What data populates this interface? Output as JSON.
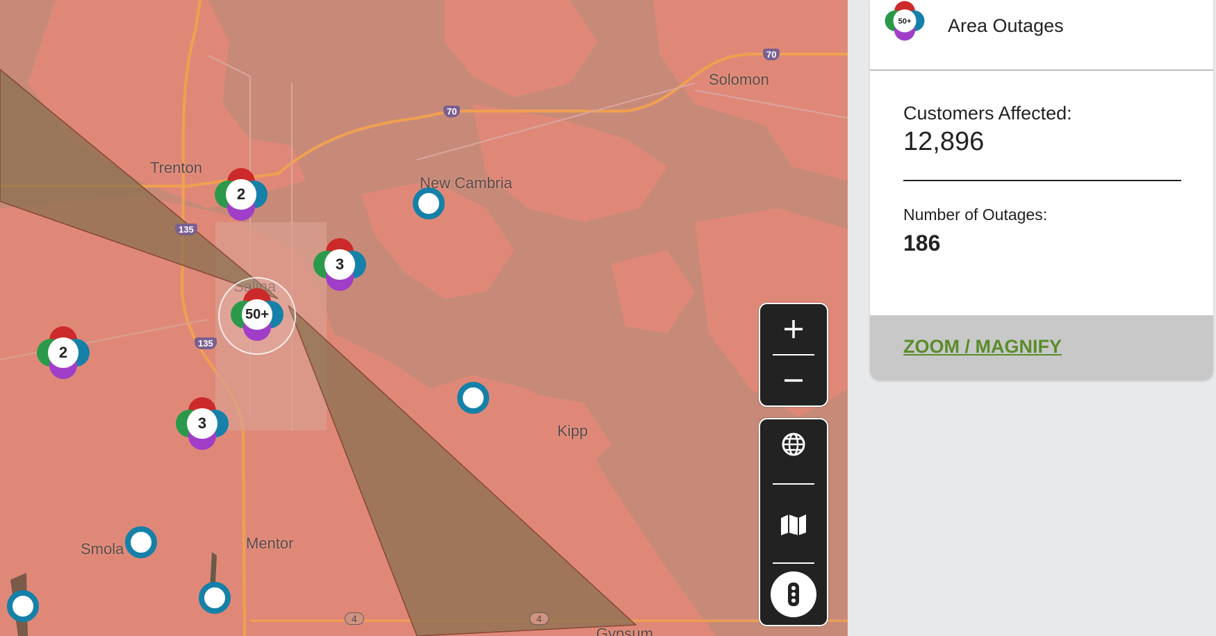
{
  "map": {
    "places": [
      {
        "name": "Trenton"
      },
      {
        "name": "New Cambria"
      },
      {
        "name": "Solomon"
      },
      {
        "name": "Salina"
      },
      {
        "name": "Kipp"
      },
      {
        "name": "Smola"
      },
      {
        "name": "Mentor"
      },
      {
        "name": "Gypsum"
      }
    ],
    "interstates": [
      "70",
      "70",
      "135",
      "135"
    ],
    "state_routes": [
      "4",
      "4"
    ],
    "clusters": [
      {
        "label": "2"
      },
      {
        "label": "3"
      },
      {
        "label": "50+"
      },
      {
        "label": "2"
      },
      {
        "label": "3"
      }
    ],
    "colors": {
      "cluster_red": "#cc2a2a",
      "cluster_green": "#2a9a4a",
      "cluster_blue": "#1580a8",
      "cluster_purple": "#a03ec8",
      "outage_area": "#e08878",
      "land": "#c88a78",
      "road": "#f0a050",
      "cone": "#8a7050"
    },
    "controls": {
      "zoom_in_icon": "plus-icon",
      "zoom_out_icon": "minus-icon",
      "globe_icon": "globe-icon",
      "map_icon": "map-icon",
      "legend_icon": "traffic-light-icon"
    }
  },
  "panel": {
    "title": "Area Outages",
    "icon_label": "50+",
    "customers_label": "Customers Affected:",
    "customers_value": "12,896",
    "outages_label": "Number of Outages:",
    "outages_value": "186",
    "zoom_link": "ZOOM / MAGNIFY"
  }
}
